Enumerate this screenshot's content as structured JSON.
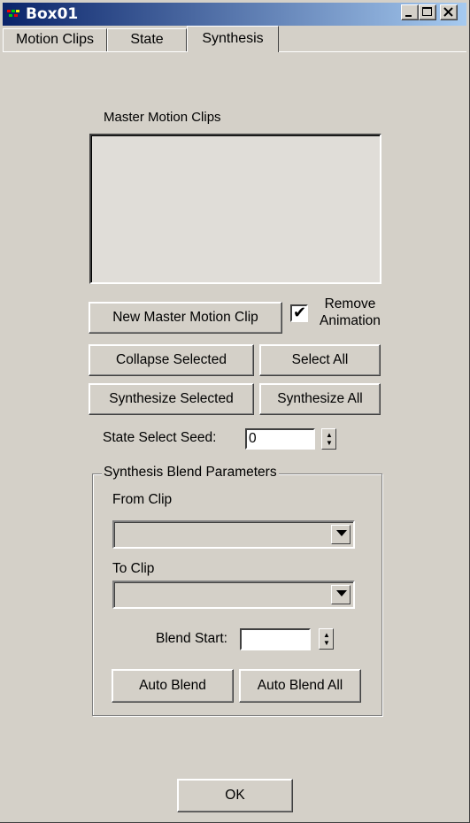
{
  "window": {
    "title": "Box01",
    "icon": "3dsmax-app-icon"
  },
  "caption_buttons": {
    "minimize": "minimize-icon",
    "maximize": "maximize-icon",
    "close": "close-icon"
  },
  "tabs": [
    {
      "label": "Motion Clips",
      "active": false
    },
    {
      "label": "State",
      "active": false
    },
    {
      "label": "Synthesis",
      "active": true
    }
  ],
  "synthesis": {
    "master_list_label": "Master Motion Clips",
    "new_master_label": "New Master Motion Clip",
    "remove_animation": {
      "label_line1": "Remove",
      "label_line2": "Animation",
      "checked": true
    },
    "collapse_selected_label": "Collapse Selected",
    "select_all_label": "Select All",
    "synthesize_selected_label": "Synthesize Selected",
    "synthesize_all_label": "Synthesize All",
    "seed_label": "State Select Seed:",
    "seed_value": "0"
  },
  "blend": {
    "group_label": "Synthesis Blend Parameters",
    "from_label": "From Clip",
    "from_value": "",
    "to_label": "To Clip",
    "to_value": "",
    "blend_start_label": "Blend Start:",
    "blend_start_value": "",
    "auto_blend_label": "Auto Blend",
    "auto_blend_all_label": "Auto Blend All"
  },
  "ok_label": "OK",
  "colors": {
    "face": "#d4d0c8",
    "title_start": "#0a246a",
    "title_end": "#a6caf0"
  }
}
